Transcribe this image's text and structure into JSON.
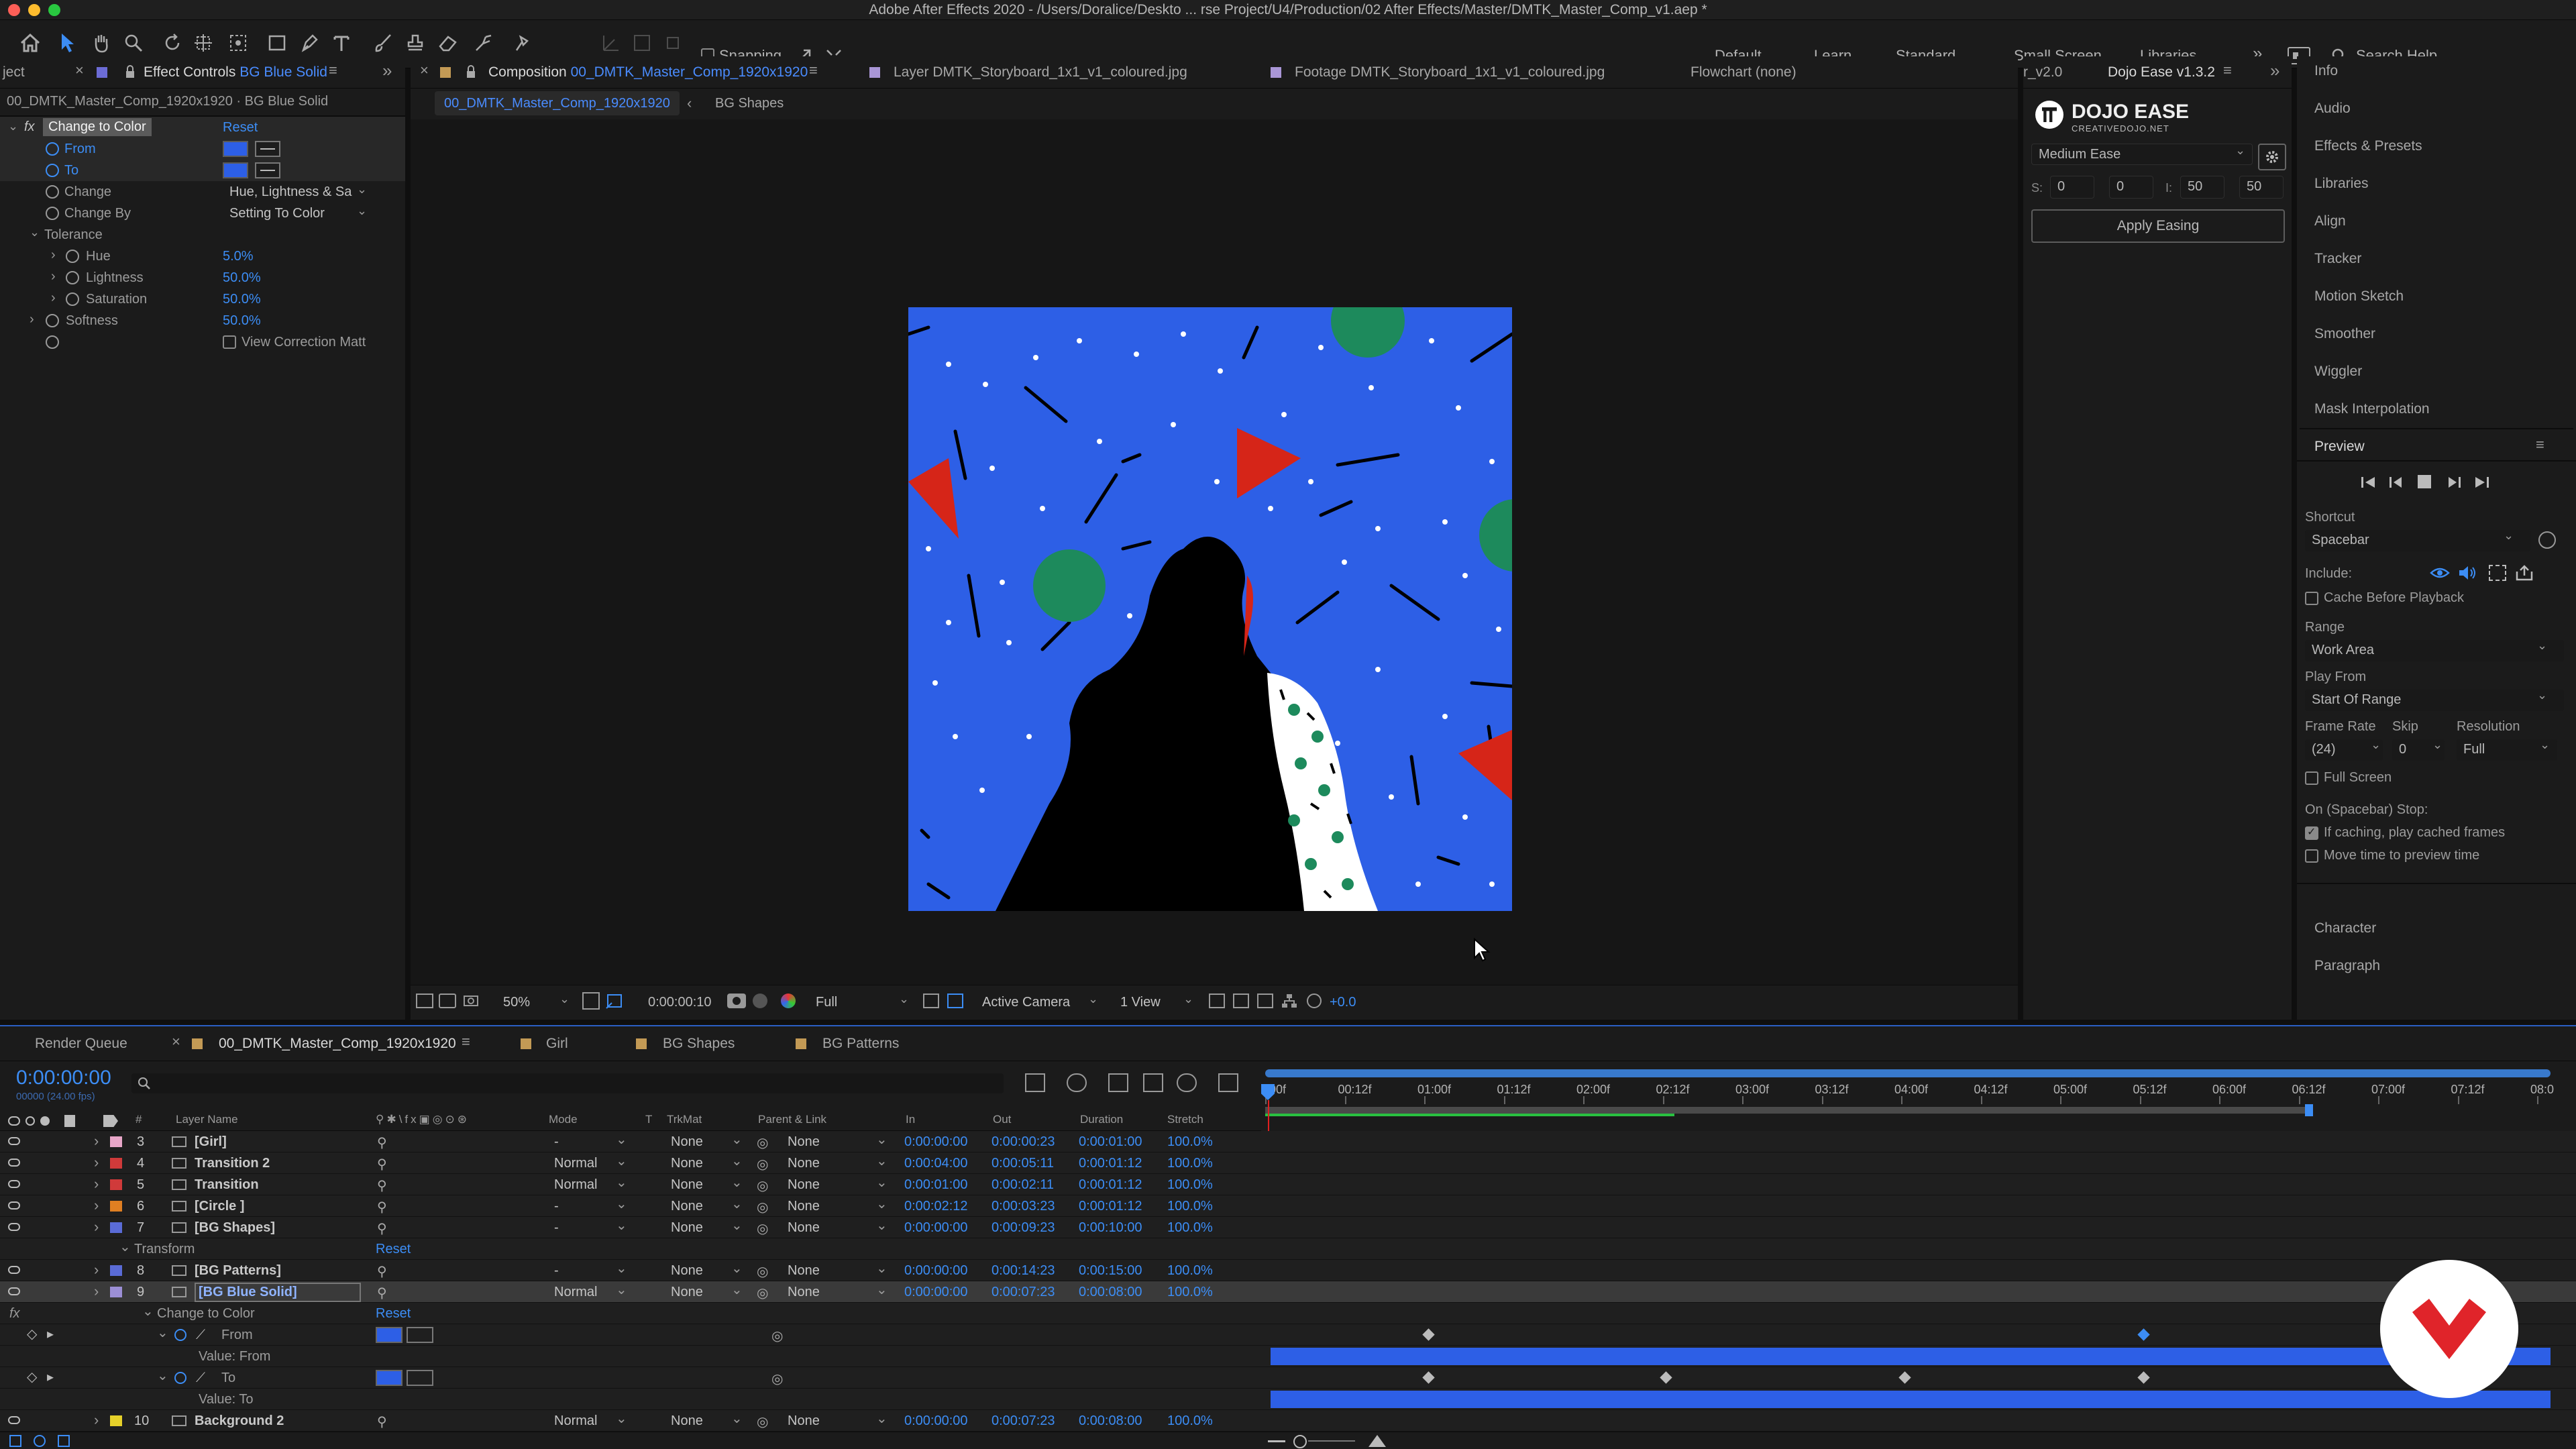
{
  "titlebar": {
    "title": "Adobe After Effects 2020 - /Users/Doralice/Deskto ... rse Project/U4/Production/02 After Effects/Master/DMTK_Master_Comp_v1.aep *"
  },
  "toolbar": {
    "snapping": "Snapping",
    "workspaces": [
      "Default",
      "Learn",
      "Standard",
      "Small Screen",
      "Libraries"
    ],
    "search_placeholder": "Search Help"
  },
  "effect_controls": {
    "tab_project": "ject",
    "tab_title": "Effect Controls",
    "tab_layer": "BG Blue Solid",
    "breadcrumb": "00_DMTK_Master_Comp_1920x1920 · BG Blue Solid",
    "effect_name": "Change to Color",
    "reset": "Reset",
    "props": {
      "from": "From",
      "to": "To",
      "change": "Change",
      "change_value": "Hue, Lightness & Sa",
      "change_by": "Change By",
      "change_by_value": "Setting To Color",
      "tolerance": "Tolerance",
      "hue": "Hue",
      "hue_value": "5.0%",
      "lightness": "Lightness",
      "lightness_value": "50.0%",
      "saturation": "Saturation",
      "saturation_value": "50.0%",
      "softness": "Softness",
      "softness_value": "50.0%",
      "view_correction": "View Correction Matt"
    }
  },
  "viewer": {
    "tabs": [
      {
        "prefix": "Composition",
        "name": "00_DMTK_Master_Comp_1920x1920"
      },
      {
        "prefix": "Layer",
        "name": "DMTK_Storyboard_1x1_v1_coloured.jpg"
      },
      {
        "prefix": "Footage",
        "name": "DMTK_Storyboard_1x1_v1_coloured.jpg"
      },
      {
        "prefix": "Flowchart",
        "name": "(none)"
      }
    ],
    "crumbs": [
      "00_DMTK_Master_Comp_1920x1920",
      "BG Shapes"
    ],
    "footer": {
      "zoom": "50%",
      "timecode": "0:00:00:10",
      "resolution": "Full",
      "camera": "Active Camera",
      "views": "1 View",
      "exposure": "+0.0"
    }
  },
  "dojo": {
    "tab_prev": "r_v2.0",
    "tab": "Dojo Ease v1.3.2",
    "brand": "DOJO EASE",
    "brand_sub": "CREATIVEDOJO.NET",
    "ease": "Medium Ease",
    "s_label": "S:",
    "s1": "0",
    "s2": "0",
    "i_label": "I:",
    "i1": "50",
    "i2": "50",
    "apply": "Apply Easing"
  },
  "right_panels": {
    "items": [
      "Info",
      "Audio",
      "Effects & Presets",
      "Libraries",
      "Align",
      "Tracker",
      "Motion Sketch",
      "Smoother",
      "Wiggler",
      "Mask Interpolation"
    ]
  },
  "preview": {
    "title": "Preview",
    "shortcut_label": "Shortcut",
    "shortcut": "Spacebar",
    "include": "Include:",
    "cache": "Cache Before Playback",
    "range_label": "Range",
    "range": "Work Area",
    "play_from_label": "Play From",
    "play_from": "Start Of Range",
    "frame_rate_label": "Frame Rate",
    "skip_label": "Skip",
    "resolution_label": "Resolution",
    "frame_rate": "(24)",
    "skip": "0",
    "resolution": "Full",
    "full_screen": "Full Screen",
    "stop_label": "On (Spacebar) Stop:",
    "if_caching": "If caching, play cached frames",
    "move_time": "Move time to preview time",
    "character": "Character",
    "paragraph": "Paragraph"
  },
  "timeline": {
    "tabs": [
      "Render Queue",
      "00_DMTK_Master_Comp_1920x1920",
      "Girl",
      "BG Shapes",
      "BG Patterns"
    ],
    "timecode": "0:00:00:00",
    "fps": "00000 (24.00 fps)",
    "columns": {
      "num": "#",
      "name": "Layer Name",
      "mode": "Mode",
      "t": "T",
      "trkmat": "TrkMat",
      "parent": "Parent & Link",
      "in": "In",
      "out": "Out",
      "duration": "Duration",
      "stretch": "Stretch"
    },
    "ruler": [
      "00f",
      "00:12f",
      "01:00f",
      "01:12f",
      "02:00f",
      "02:12f",
      "03:00f",
      "03:12f",
      "04:00f",
      "04:12f",
      "05:00f",
      "05:12f",
      "06:00f",
      "06:12f",
      "07:00f",
      "07:12f",
      "08:0"
    ],
    "layers": [
      {
        "num": "3",
        "name": "[Girl]",
        "mode": "-",
        "trkmat": "None",
        "parent": "None",
        "in": "0:00:00:00",
        "out": "0:00:00:23",
        "duration": "0:00:01:00",
        "stretch": "100.0%",
        "color": "#e8a7c9"
      },
      {
        "num": "4",
        "name": "Transition 2",
        "mode": "Normal",
        "trkmat": "None",
        "parent": "None",
        "in": "0:00:04:00",
        "out": "0:00:05:11",
        "duration": "0:00:01:12",
        "stretch": "100.0%",
        "color": "#d03a3a"
      },
      {
        "num": "5",
        "name": "Transition",
        "mode": "Normal",
        "trkmat": "None",
        "parent": "None",
        "in": "0:00:01:00",
        "out": "0:00:02:11",
        "duration": "0:00:01:12",
        "stretch": "100.0%",
        "color": "#d03a3a"
      },
      {
        "num": "6",
        "name": "[Circle ]",
        "mode": "-",
        "trkmat": "None",
        "parent": "None",
        "in": "0:00:02:12",
        "out": "0:00:03:23",
        "duration": "0:00:01:12",
        "stretch": "100.0%",
        "color": "#e07f22"
      },
      {
        "num": "7",
        "name": "[BG Shapes]",
        "mode": "-",
        "trkmat": "None",
        "parent": "None",
        "in": "0:00:00:00",
        "out": "0:00:09:23",
        "duration": "0:00:10:00",
        "stretch": "100.0%",
        "color": "#5a6bd6"
      },
      {
        "num": "8",
        "name": "[BG Patterns]",
        "mode": "-",
        "trkmat": "None",
        "parent": "None",
        "in": "0:00:00:00",
        "out": "0:00:14:23",
        "duration": "0:00:15:00",
        "stretch": "100.0%",
        "color": "#5a6bd6"
      },
      {
        "num": "9",
        "name": "[BG Blue Solid]",
        "mode": "Normal",
        "trkmat": "None",
        "parent": "None",
        "in": "0:00:00:00",
        "out": "0:00:07:23",
        "duration": "0:00:08:00",
        "stretch": "100.0%",
        "color": "#9c8fd6"
      },
      {
        "num": "10",
        "name": "Background 2",
        "mode": "Normal",
        "trkmat": "None",
        "parent": "None",
        "in": "0:00:00:00",
        "out": "0:00:07:23",
        "duration": "0:00:08:00",
        "stretch": "100.0%",
        "color": "#e6d12a"
      }
    ],
    "sub": {
      "transform": "Transform",
      "reset": "Reset",
      "effect": "Change to Color",
      "from": "From",
      "value_from": "Value: From",
      "to": "To",
      "value_to": "Value: To",
      "fx": "fx"
    }
  },
  "colors": {
    "accent": "#3c8df5",
    "canvas_blue": "#2d5fe6",
    "red": "#d62518",
    "green": "#1d8a5c",
    "playhead": "#e02020"
  }
}
